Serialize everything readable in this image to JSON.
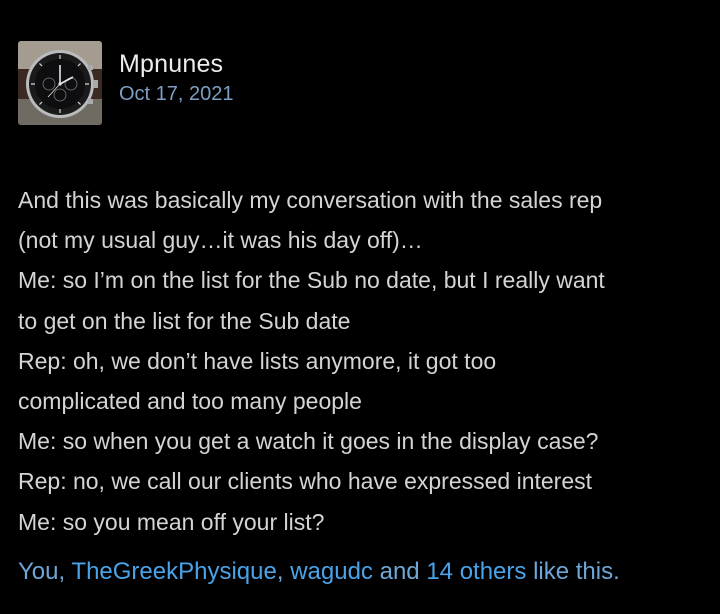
{
  "post": {
    "author": "Mpnunes",
    "date": "Oct 17, 2021",
    "avatar_icon": "watch-avatar",
    "lines": [
      "And this was basically my conversation with the sales rep",
      "(not my usual guy…it was his day off)…",
      "Me: so I’m on the list for the Sub no date, but I really want",
      "to get on the list for the Sub date",
      "Rep: oh, we don’t have lists anymore, it got too",
      "complicated and too many people",
      "Me: so when you get a watch it goes in the display case?",
      "Rep: no, we call our clients who have expressed interest",
      "Me: so you mean off your list?"
    ]
  },
  "reactions": {
    "you": "You,",
    "user1": "TheGreekPhysique",
    "comma": ",",
    "user2": "wagudc",
    "and": "and",
    "others": "14 others",
    "suffix": "like this."
  },
  "colors": {
    "background": "#000000",
    "text": "#d4d4d4",
    "date": "#7d9fc3",
    "link": "#4aa3e8"
  }
}
